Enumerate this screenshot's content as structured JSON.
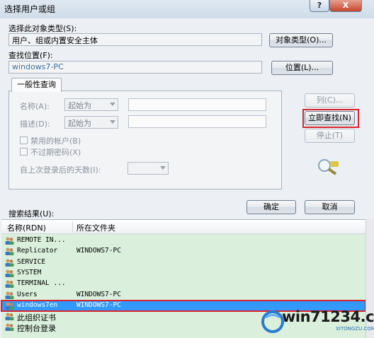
{
  "window": {
    "title": "选择用户或组",
    "help": "?",
    "close": "X"
  },
  "object_type": {
    "label": "选择此对象类型(S):",
    "value": "用户、组或内置安全主体",
    "button": "对象类型(O)..."
  },
  "location": {
    "label": "查找位置(F):",
    "value": "windows7-PC",
    "button": "位置(L)..."
  },
  "query": {
    "tab": "一般性查询",
    "name_label": "名称(A):",
    "name_mode": "起始为",
    "desc_label": "描述(D):",
    "desc_mode": "起始为",
    "disabled_accounts": "禁用的帐户(B)",
    "no_expire_pwd": "不过期密码(X)",
    "days_since_login": "自上次登录后的天数(I):",
    "columns_button": "列(C)...",
    "find_now_button": "立即查找(N)",
    "stop_button": "停止(T)"
  },
  "dialog": {
    "ok": "确定",
    "cancel": "取消"
  },
  "results": {
    "label": "搜索结果(U):",
    "columns": [
      "名称(RDN)",
      "所在文件夹"
    ],
    "rows": [
      {
        "name": "REMOTE IN...",
        "folder": ""
      },
      {
        "name": "Replicator",
        "folder": "WINDOWS7-PC"
      },
      {
        "name": "SERVICE",
        "folder": ""
      },
      {
        "name": "SYSTEM",
        "folder": ""
      },
      {
        "name": "TERMINAL ...",
        "folder": ""
      },
      {
        "name": "Users",
        "folder": "WINDOWS7-PC"
      },
      {
        "name": "windows7en",
        "folder": "WINDOWS7-PC"
      },
      {
        "name": "此组织证书",
        "folder": ""
      },
      {
        "name": "控制台登录",
        "folder": ""
      }
    ]
  },
  "watermark": {
    "text": "win71234.com",
    "url": "XITONGZU.COM"
  },
  "colors": {
    "selection": "#3399ff",
    "highlight_box": "#d9252b",
    "results_bg": "#dbf0dc"
  }
}
